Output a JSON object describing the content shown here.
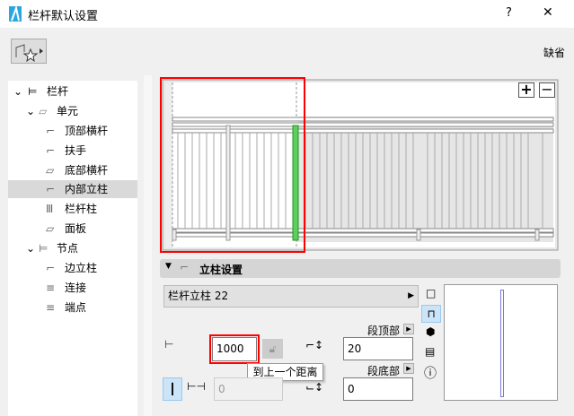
{
  "window": {
    "title": "栏杆默认设置",
    "help": "?",
    "close": "✕"
  },
  "header": {
    "default_label": "缺省"
  },
  "tree": [
    {
      "label": "栏杆"
    },
    {
      "label": "单元"
    },
    {
      "label": "顶部横杆"
    },
    {
      "label": "扶手"
    },
    {
      "label": "底部横杆"
    },
    {
      "label": "内部立柱"
    },
    {
      "label": "栏杆柱"
    },
    {
      "label": "面板"
    },
    {
      "label": "节点"
    },
    {
      "label": "边立柱"
    },
    {
      "label": "连接"
    },
    {
      "label": "端点"
    }
  ],
  "preview": {
    "zoom_in": "+",
    "zoom_out": "−"
  },
  "section": {
    "title": "立柱设置",
    "profile": "栏杆立柱 22",
    "distance_value": "1000",
    "distance_tooltip": "到上一个距离",
    "count_value": "0",
    "top_label": "段顶部",
    "top_value": "20",
    "bottom_label": "段底部",
    "bottom_value": "0"
  },
  "colors": {
    "highlight": "#ff0000",
    "selected_post": "#5ad15a"
  }
}
